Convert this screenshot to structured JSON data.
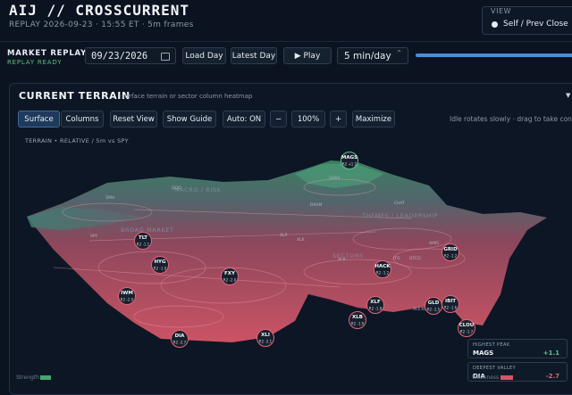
{
  "header": {
    "title": "AIJ // CROSSCURRENT",
    "subtitle": "REPLAY 2026-09-23 · 15:55 ET · 5m frames"
  },
  "view": {
    "label": "VIEW",
    "option": "Self / Prev Close"
  },
  "replay": {
    "title": "MARKET REPLAY",
    "status": "REPLAY READY",
    "date_value": "09/23/2026",
    "load_label": "Load Day",
    "latest_label": "Latest Day",
    "play_label": "▶ Play",
    "interval_value": "5 min/day",
    "accent": "#4a8fd6"
  },
  "terrain": {
    "title": "CURRENT TERRAIN",
    "subtitle": "surface terrain or sector column heatmap",
    "caption": "TERRAIN • RELATIVE / 5m vs SPY",
    "toolbar": {
      "surface": "Surface",
      "columns": "Columns",
      "reset": "Reset View",
      "guide": "Show Guide",
      "auto": "Auto: ON",
      "minus": "−",
      "zoom": "100%",
      "plus": "+",
      "maximize": "Maximize",
      "hint": "Idle rotates slowly · drag to take control"
    },
    "regions": {
      "macro": "MACRO / RISK",
      "broad": "BROAD MARKET",
      "themes": "THEMES / LEADERSHIP",
      "sectors": "SECTORS"
    },
    "minor_labels": [
      "SMH",
      "QQQ",
      "SOXX",
      "DRAM",
      "CHAT",
      "SPY",
      "XLP",
      "XLK",
      "AIMS",
      "XLB",
      "ITO",
      "DTCO",
      "XLV",
      "XLE"
    ],
    "markers": [
      {
        "name": "MAGS",
        "value": "R2 +1.1",
        "color": "#5ec48c"
      },
      {
        "name": "TLT",
        "value": "R2 -1.1",
        "color": "#e3667a"
      },
      {
        "name": "HYG",
        "value": "R2 -1.0",
        "color": "#e3667a"
      },
      {
        "name": "FXY",
        "value": "R2 -2.0",
        "color": "#e3667a"
      },
      {
        "name": "IWM",
        "value": "R2 -2.0",
        "color": "#e3667a"
      },
      {
        "name": "DIA",
        "value": "R2 -2.7",
        "color": "#e3667a"
      },
      {
        "name": "XLI",
        "value": "R2 -2.1",
        "color": "#e3667a"
      },
      {
        "name": "XLF",
        "value": "R2 -1.8",
        "color": "#e3667a"
      },
      {
        "name": "XLB",
        "value": "R2 -1.9",
        "color": "#e3667a"
      },
      {
        "name": "HACK",
        "value": "R2 -1.2",
        "color": "#e3667a"
      },
      {
        "name": "GRID",
        "value": "R2 -1.2",
        "color": "#e3667a"
      },
      {
        "name": "GLD",
        "value": "R2 -1.5",
        "color": "#e3667a"
      },
      {
        "name": "IBIT",
        "value": "R2 -1.6",
        "color": "#e3667a"
      },
      {
        "name": "CLOU",
        "value": "R2 -1.7",
        "color": "#e3667a"
      }
    ],
    "stats": {
      "peak_label": "HIGHEST PEAK",
      "peak_name": "MAGS",
      "peak_value": "+1.1",
      "peak_color": "#5ec48c",
      "valley_label": "DEEPEST VALLEY",
      "valley_name": "DIA",
      "valley_value": "-2.7",
      "valley_color": "#e3667a"
    },
    "legend": {
      "strength": "Strength",
      "weakness": "Weakness"
    },
    "colors": {
      "up": "#5ec48c",
      "down": "#e3667a",
      "surface_high": "#3d8a68",
      "surface_low": "#e05a6c"
    }
  }
}
